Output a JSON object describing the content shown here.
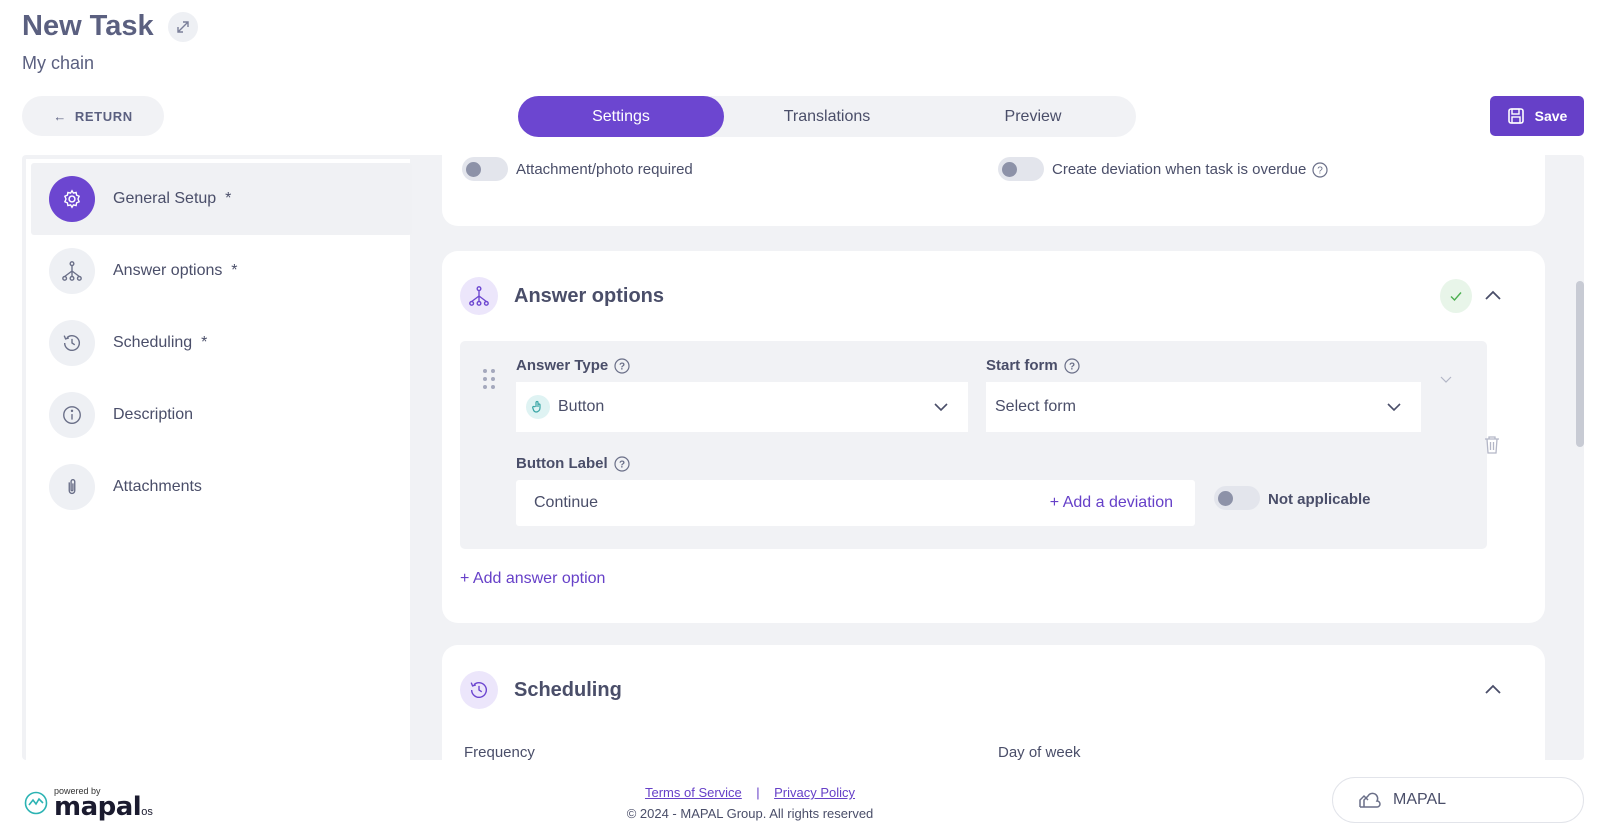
{
  "header": {
    "title": "New Task",
    "subtitle": "My chain",
    "return_label": "RETURN",
    "save_label": "Save"
  },
  "tabs": [
    {
      "label": "Settings",
      "active": true
    },
    {
      "label": "Translations"
    },
    {
      "label": "Preview"
    }
  ],
  "sidebar": {
    "items": [
      {
        "label": "General Setup",
        "required": "*",
        "icon": "gear-icon",
        "active": true
      },
      {
        "label": "Answer options",
        "required": "*",
        "icon": "hierarchy-icon"
      },
      {
        "label": "Scheduling",
        "required": "*",
        "icon": "history-icon"
      },
      {
        "label": "Description",
        "required": "",
        "icon": "info-icon"
      },
      {
        "label": "Attachments",
        "required": "",
        "icon": "paperclip-icon"
      }
    ]
  },
  "general_card": {
    "attachment_toggle_label": "Attachment/photo required",
    "deviation_toggle_label": "Create deviation when task is overdue"
  },
  "answer_options": {
    "title": "Answer options",
    "answer_type_label": "Answer Type",
    "answer_type_value": "Button",
    "start_form_label": "Start form",
    "start_form_placeholder": "Select form",
    "button_label_label": "Button Label",
    "button_label_value": "Continue",
    "add_deviation": "+ Add a deviation",
    "not_applicable": "Not applicable",
    "add_answer_option": "+ Add answer option"
  },
  "scheduling": {
    "title": "Scheduling",
    "frequency_label": "Frequency",
    "day_of_week_label": "Day of week"
  },
  "footer": {
    "terms": "Terms of Service",
    "separator": "|",
    "privacy": "Privacy Policy",
    "copyright": "© 2024 - MAPAL Group. All rights reserved",
    "org_button": "MAPAL",
    "powered_by": "powered by",
    "brand": "mapal",
    "brand_suffix": "os"
  },
  "colors": {
    "accent": "#6c46d0",
    "save": "#6640c8",
    "success": "#4caf50"
  }
}
